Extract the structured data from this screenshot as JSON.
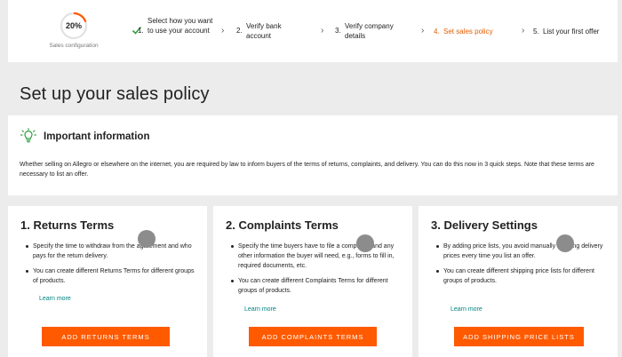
{
  "stepper": {
    "progress": {
      "value": "20%",
      "fraction": 0.2,
      "label": "Sales configuration"
    },
    "steps": [
      {
        "number": "1.",
        "label": "Select how you want to use your account",
        "status": "done"
      },
      {
        "number": "2.",
        "label": "Verify bank account",
        "status": "pending"
      },
      {
        "number": "3.",
        "label": "Verify company details",
        "status": "pending"
      },
      {
        "number": "4.",
        "label": "Set sales policy",
        "status": "active"
      },
      {
        "number": "5.",
        "label": "List your first offer",
        "status": "pending"
      }
    ]
  },
  "page": {
    "title": "Set up your sales policy"
  },
  "info": {
    "title": "Important information",
    "text": "Whether selling on Allegro or elsewhere on the internet, you are required by law to inform buyers of the terms of returns, complaints, and delivery. You can do this now in 3 quick steps. Note that these terms are necessary to list an offer."
  },
  "cards": [
    {
      "title": "1. Returns Terms",
      "bullets": [
        "Specify the time to withdraw from the agreement and who pays for the return delivery.",
        "You can create different Returns Terms for different groups of products."
      ],
      "learn_more": "Learn more",
      "button": "ADD RETURNS TERMS"
    },
    {
      "title": "2. Complaints Terms",
      "bullets": [
        "Specify the time buyers have to file a complaint, and any other information the buyer will need, e.g., forms to fill in, required documents, etc.",
        "You can create different Complaints Terms for different groups of products."
      ],
      "learn_more": "Learn more",
      "button": "ADD COMPLAINTS TERMS"
    },
    {
      "title": "3. Delivery Settings",
      "bullets": [
        "By adding price lists, you avoid manually entering delivery prices every time you list an offer.",
        "You can create different shipping price lists for different groups of products."
      ],
      "learn_more": "Learn more",
      "button": "ADD SHIPPING PRICE LISTS"
    }
  ],
  "colors": {
    "accent": "#ff5a00",
    "link": "#00827f",
    "check": "#2e9d3e",
    "active_step": "#e65c00"
  }
}
